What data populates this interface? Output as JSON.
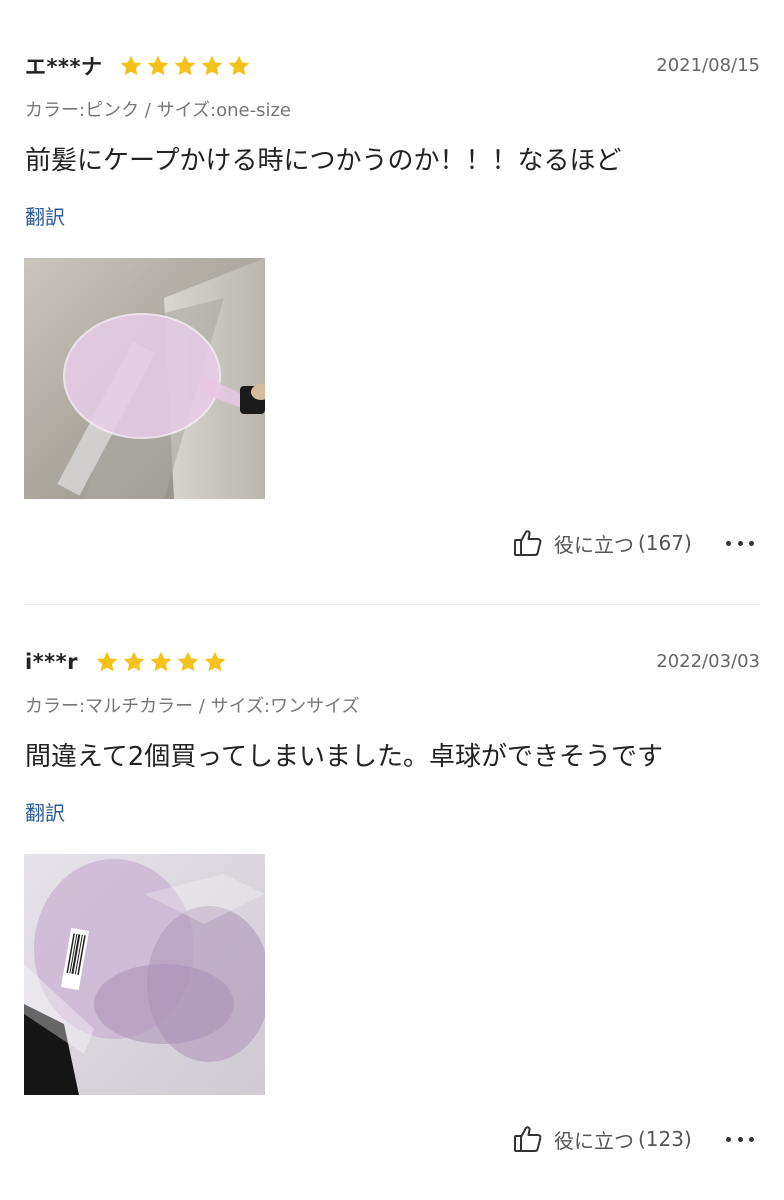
{
  "colors": {
    "star": "#f5c21b",
    "link": "#2a5d9c"
  },
  "reviews": [
    {
      "username": "エ***ナ",
      "rating": 5,
      "date": "2021/08/15",
      "variant": "カラー:ピンク / サイズ:one-size",
      "text": "前髪にケープかける時につかうのか！！！なるほど",
      "translate_label": "翻訳",
      "helpful_label": "役に立つ",
      "helpful_count": "(167)",
      "more_icon": "more-dots-icon",
      "thumb_icon": "thumbs-up-icon"
    },
    {
      "username": "i***r",
      "rating": 5,
      "date": "2022/03/03",
      "variant": "カラー:マルチカラー / サイズ:ワンサイズ",
      "text": "間違えて2個買ってしまいました。卓球ができそうです",
      "translate_label": "翻訳",
      "helpful_label": "役に立つ",
      "helpful_count": "(123)",
      "more_icon": "more-dots-icon",
      "thumb_icon": "thumbs-up-icon"
    }
  ]
}
